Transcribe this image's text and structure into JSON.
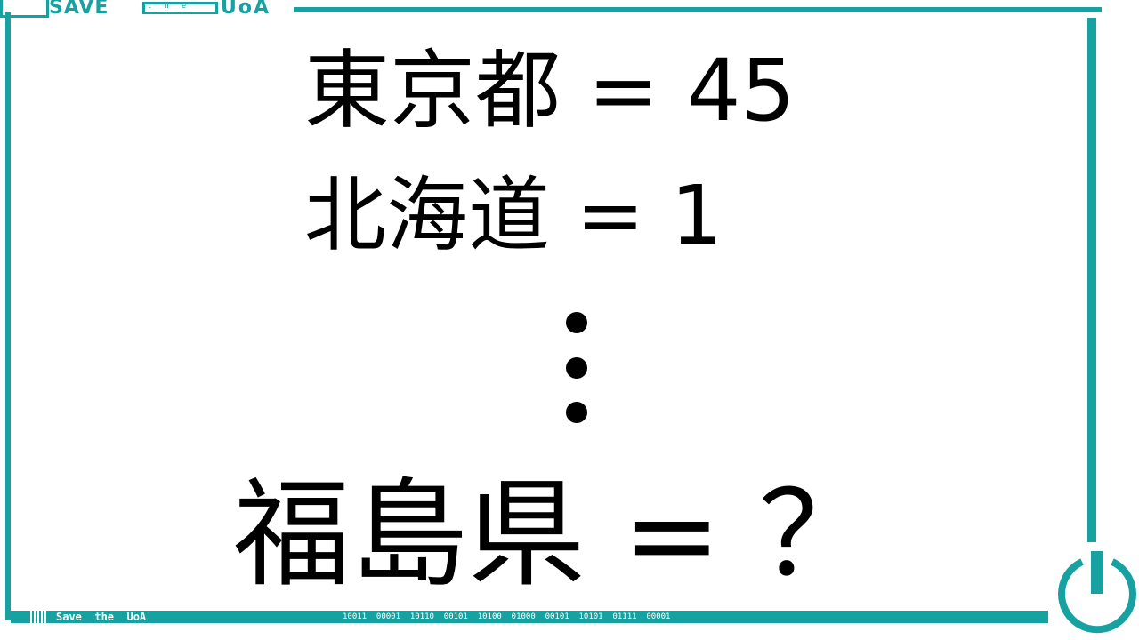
{
  "brand": {
    "logo_word_1": "SAVE",
    "logo_word_2": "the",
    "logo_word_3": "UoA",
    "footer_label": "Save  the  UoA",
    "footer_code": "10011  00001  10110  00101  10100  01000  00101  10101  01111  00001",
    "accent_color": "#17a2a1"
  },
  "puzzle": {
    "line1": "東京都 = 45",
    "line2": "北海道 = 1",
    "line3": "福島県 = ？"
  },
  "icons": {
    "power": "power-icon",
    "ellipsis": "vertical-ellipsis-icon"
  }
}
